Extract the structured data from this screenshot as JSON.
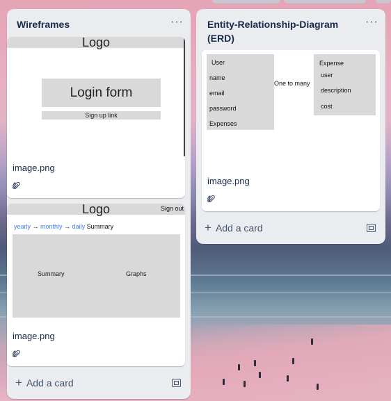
{
  "columns": [
    {
      "title": "Wireframes",
      "menu": "···",
      "cards": [
        {
          "mockup": {
            "logo": "Logo",
            "form": "Login form",
            "link": "Sign up link"
          },
          "title": "image.png",
          "attachments": "1"
        },
        {
          "mockup": {
            "logo": "Logo",
            "signout": "Sign out",
            "breadcrumb": {
              "yearly": "yearly",
              "arrow1": "→",
              "monthly": "monthly",
              "arrow2": "→",
              "daily": "daily",
              "summary": "Summary"
            },
            "summary": "Summary",
            "graphs": "Graphs"
          },
          "title": "image.png",
          "attachments": "1"
        }
      ],
      "add_card": "Add a card"
    },
    {
      "title": "Entity-Relationship-Diagram (ERD)",
      "menu": "···",
      "cards": [
        {
          "erd": {
            "user": {
              "title": "User",
              "fields": [
                "name",
                "email",
                "password",
                "Expenses"
              ]
            },
            "relation": "One to many",
            "expense": {
              "title": "Expense",
              "fields": [
                "user",
                "description",
                "cost"
              ]
            }
          },
          "title": "image.png",
          "attachments": "1"
        }
      ],
      "add_card": "Add a card"
    }
  ],
  "icons": {
    "menu": "more-icon",
    "attachment": "paperclip-icon",
    "add": "plus-icon",
    "template": "card-template-icon"
  },
  "colors": {
    "column_bg": "#ebecf0",
    "text": "#172b4d",
    "muted": "#44546f",
    "link_blue": "#3b82f6"
  }
}
